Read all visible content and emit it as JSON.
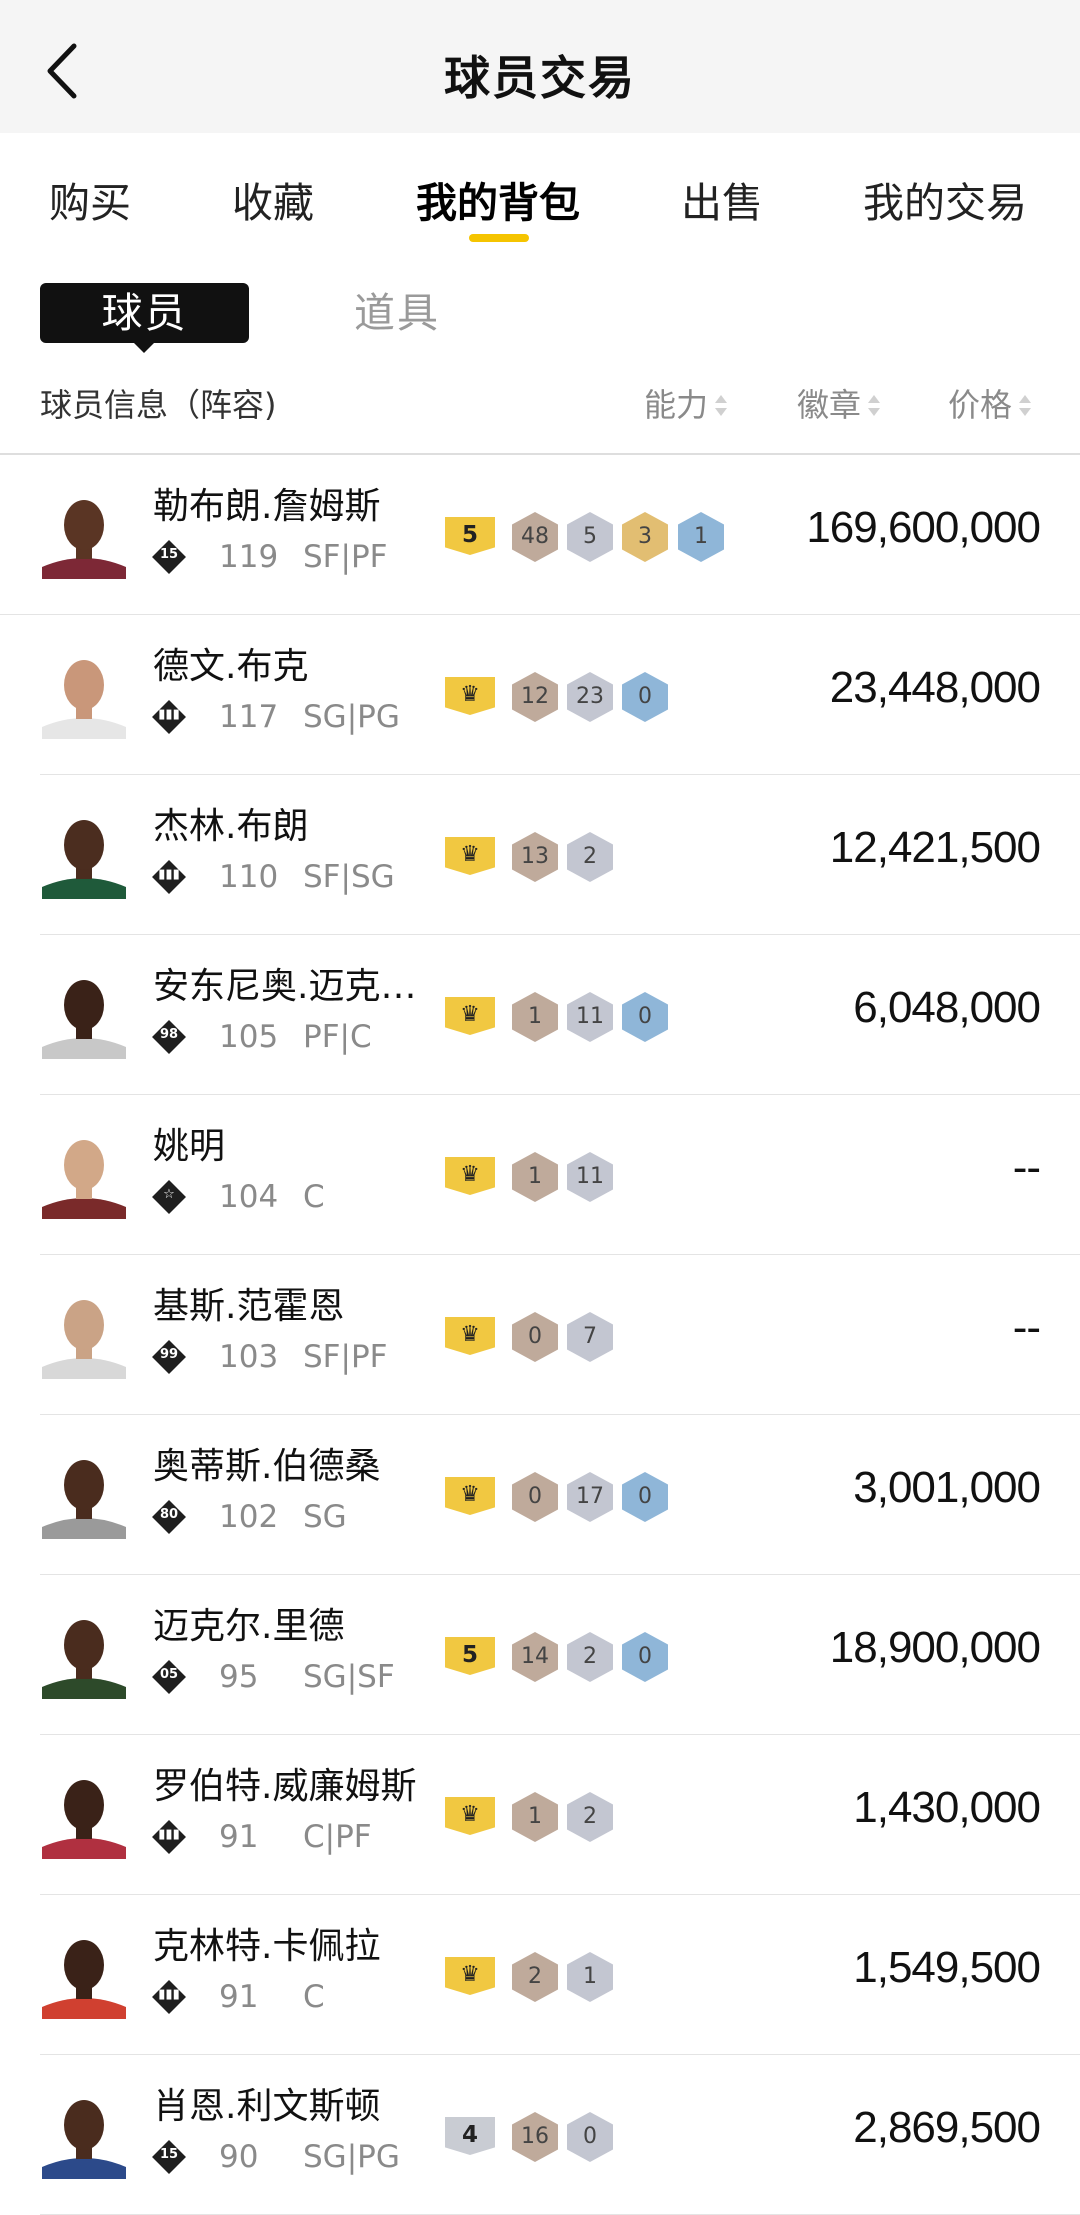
{
  "header": {
    "title": "球员交易",
    "back_icon": "back-arrow-icon"
  },
  "tabs": [
    {
      "label": "购买",
      "active": false
    },
    {
      "label": "收藏",
      "active": false
    },
    {
      "label": "我的背包",
      "active": true
    },
    {
      "label": "出售",
      "active": false
    },
    {
      "label": "我的交易",
      "active": false
    }
  ],
  "subtabs": [
    {
      "label": "球员",
      "active": true
    },
    {
      "label": "道具",
      "active": false
    }
  ],
  "columns": {
    "info": "球员信息（阵容)",
    "ability": "能力",
    "badge": "徽章",
    "price": "价格"
  },
  "colors": {
    "accent": "#f5c400",
    "gold_badge": "#e2be72",
    "silver_badge": "#c3c6d1",
    "bronze_badge": "#bfaa9b",
    "blue_badge": "#8fb6d8"
  },
  "players": [
    {
      "name": "勒布朗.詹姆斯",
      "lineup": "15",
      "ovr": "119",
      "pos": "SF|PF",
      "tier": "5",
      "tier_style": "gold",
      "badges": [
        {
          "v": "48",
          "c": "bronze"
        },
        {
          "v": "5",
          "c": "silver"
        },
        {
          "v": "3",
          "c": "gold"
        },
        {
          "v": "1",
          "c": "blue"
        }
      ],
      "price": "169,600,000",
      "jersey": "#7d2836",
      "skin": "#5a3524"
    },
    {
      "name": "德文.布克",
      "lineup": "signal",
      "ovr": "117",
      "pos": "SG|PG",
      "tier": "crown",
      "tier_style": "gold",
      "badges": [
        {
          "v": "12",
          "c": "bronze"
        },
        {
          "v": "23",
          "c": "silver"
        },
        {
          "v": "0",
          "c": "blue"
        }
      ],
      "price": "23,448,000",
      "jersey": "#e6e6e6",
      "skin": "#c9977a"
    },
    {
      "name": "杰林.布朗",
      "lineup": "signal",
      "ovr": "110",
      "pos": "SF|SG",
      "tier": "crown",
      "tier_style": "gold",
      "badges": [
        {
          "v": "13",
          "c": "bronze"
        },
        {
          "v": "2",
          "c": "silver"
        }
      ],
      "price": "12,421,500",
      "jersey": "#1f5a3a",
      "skin": "#4b2d1f"
    },
    {
      "name": "安东尼奥.迈克…",
      "lineup": "98",
      "ovr": "105",
      "pos": "PF|C",
      "tier": "crown",
      "tier_style": "gold",
      "badges": [
        {
          "v": "1",
          "c": "bronze"
        },
        {
          "v": "11",
          "c": "silver"
        },
        {
          "v": "0",
          "c": "blue"
        }
      ],
      "price": "6,048,000",
      "jersey": "#c8c8c8",
      "skin": "#3a2218"
    },
    {
      "name": "姚明",
      "lineup": "star",
      "ovr": "104",
      "pos": "C",
      "tier": "crown",
      "tier_style": "gold",
      "badges": [
        {
          "v": "1",
          "c": "bronze"
        },
        {
          "v": "11",
          "c": "silver"
        }
      ],
      "price": "--",
      "jersey": "#7a2a2a",
      "skin": "#d2a888"
    },
    {
      "name": "基斯.范霍恩",
      "lineup": "99",
      "ovr": "103",
      "pos": "SF|PF",
      "tier": "crown",
      "tier_style": "gold",
      "badges": [
        {
          "v": "0",
          "c": "bronze"
        },
        {
          "v": "7",
          "c": "silver"
        }
      ],
      "price": "--",
      "jersey": "#d8d8d8",
      "skin": "#caa386"
    },
    {
      "name": "奥蒂斯.伯德桑",
      "lineup": "80",
      "ovr": "102",
      "pos": "SG",
      "tier": "crown",
      "tier_style": "gold",
      "badges": [
        {
          "v": "0",
          "c": "bronze"
        },
        {
          "v": "17",
          "c": "silver"
        },
        {
          "v": "0",
          "c": "blue"
        }
      ],
      "price": "3,001,000",
      "jersey": "#9a9a9a",
      "skin": "#4a2c1e"
    },
    {
      "name": "迈克尔.里德",
      "lineup": "05",
      "ovr": "95",
      "pos": "SG|SF",
      "tier": "5",
      "tier_style": "gold",
      "badges": [
        {
          "v": "14",
          "c": "bronze"
        },
        {
          "v": "2",
          "c": "silver"
        },
        {
          "v": "0",
          "c": "blue"
        }
      ],
      "price": "18,900,000",
      "jersey": "#2d4a2a",
      "skin": "#4a2c1e"
    },
    {
      "name": "罗伯特.威廉姆斯",
      "lineup": "signal",
      "ovr": "91",
      "pos": "C|PF",
      "tier": "crown",
      "tier_style": "gold",
      "badges": [
        {
          "v": "1",
          "c": "bronze"
        },
        {
          "v": "2",
          "c": "silver"
        }
      ],
      "price": "1,430,000",
      "jersey": "#b03040",
      "skin": "#3a2218"
    },
    {
      "name": "克林特.卡佩拉",
      "lineup": "signal",
      "ovr": "91",
      "pos": "C",
      "tier": "crown",
      "tier_style": "gold",
      "badges": [
        {
          "v": "2",
          "c": "bronze"
        },
        {
          "v": "1",
          "c": "silver"
        }
      ],
      "price": "1,549,500",
      "jersey": "#d04030",
      "skin": "#3a2218"
    },
    {
      "name": "肖恩.利文斯顿",
      "lineup": "15",
      "ovr": "90",
      "pos": "SG|PG",
      "tier": "4",
      "tier_style": "silver",
      "badges": [
        {
          "v": "16",
          "c": "bronze"
        },
        {
          "v": "0",
          "c": "silver"
        }
      ],
      "price": "2,869,500",
      "jersey": "#2c4a8a",
      "skin": "#4a2c1e"
    }
  ]
}
